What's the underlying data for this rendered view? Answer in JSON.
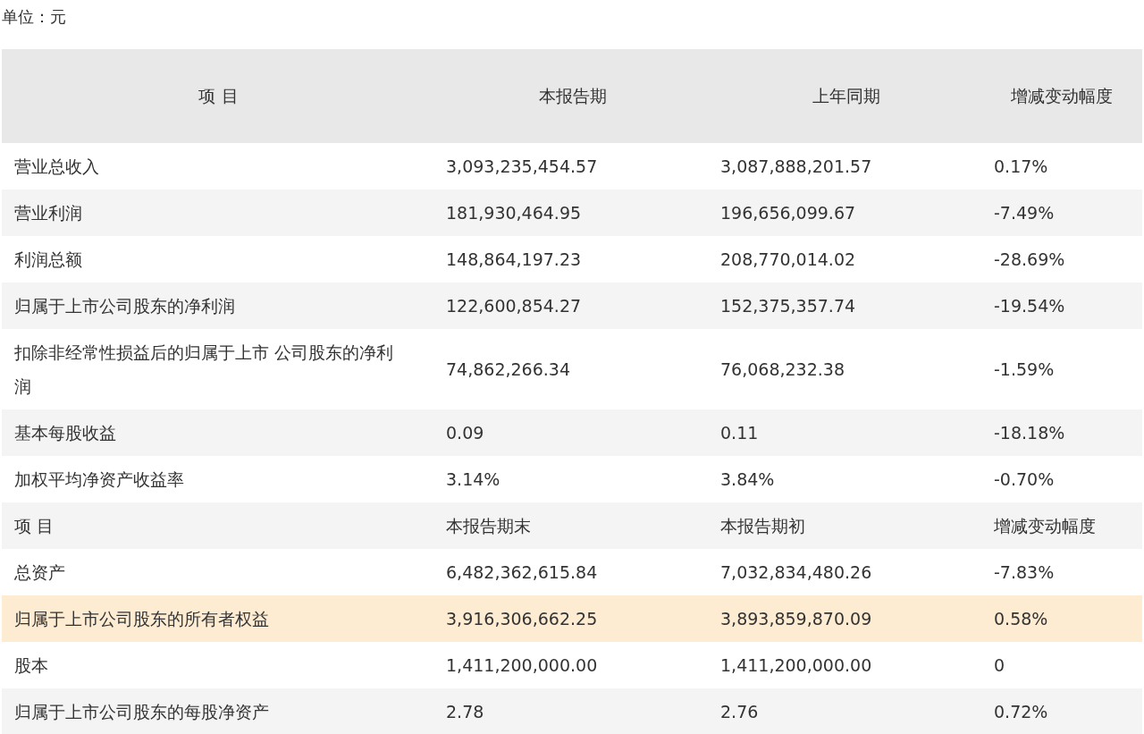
{
  "unit_label": "单位：元",
  "table": {
    "columns": [
      "项 目",
      "本报告期",
      "上年同期",
      "增减变动幅度"
    ],
    "rows": [
      {
        "cells": [
          "营业总收入",
          "3,093,235,454.57",
          "3,087,888,201.57",
          "0.17%"
        ],
        "highlighted": false
      },
      {
        "cells": [
          "营业利润",
          "181,930,464.95",
          "196,656,099.67",
          "-7.49%"
        ],
        "highlighted": false
      },
      {
        "cells": [
          "利润总额",
          "148,864,197.23",
          "208,770,014.02",
          "-28.69%"
        ],
        "highlighted": false
      },
      {
        "cells": [
          "归属于上市公司股东的净利润",
          "122,600,854.27",
          "152,375,357.74",
          "-19.54%"
        ],
        "highlighted": false
      },
      {
        "cells": [
          "扣除非经常性损益后的归属于上市 公司股东的净利润",
          "74,862,266.34",
          "76,068,232.38",
          "-1.59%"
        ],
        "highlighted": false
      },
      {
        "cells": [
          "基本每股收益",
          "0.09",
          "0.11",
          "-18.18%"
        ],
        "highlighted": false
      },
      {
        "cells": [
          "加权平均净资产收益率",
          "3.14%",
          "3.84%",
          "-0.70%"
        ],
        "highlighted": false
      },
      {
        "cells": [
          "项 目",
          "本报告期末",
          "本报告期初",
          "增减变动幅度"
        ],
        "highlighted": false
      },
      {
        "cells": [
          "总资产",
          "6,482,362,615.84",
          "7,032,834,480.26",
          "-7.83%"
        ],
        "highlighted": false
      },
      {
        "cells": [
          "归属于上市公司股东的所有者权益",
          "3,916,306,662.25",
          "3,893,859,870.09",
          "0.58%"
        ],
        "highlighted": true
      },
      {
        "cells": [
          "股本",
          "1,411,200,000.00",
          "1,411,200,000.00",
          "0"
        ],
        "highlighted": false
      },
      {
        "cells": [
          "归属于上市公司股东的每股净资产",
          "2.78",
          "2.76",
          "0.72%"
        ],
        "highlighted": false
      }
    ]
  }
}
